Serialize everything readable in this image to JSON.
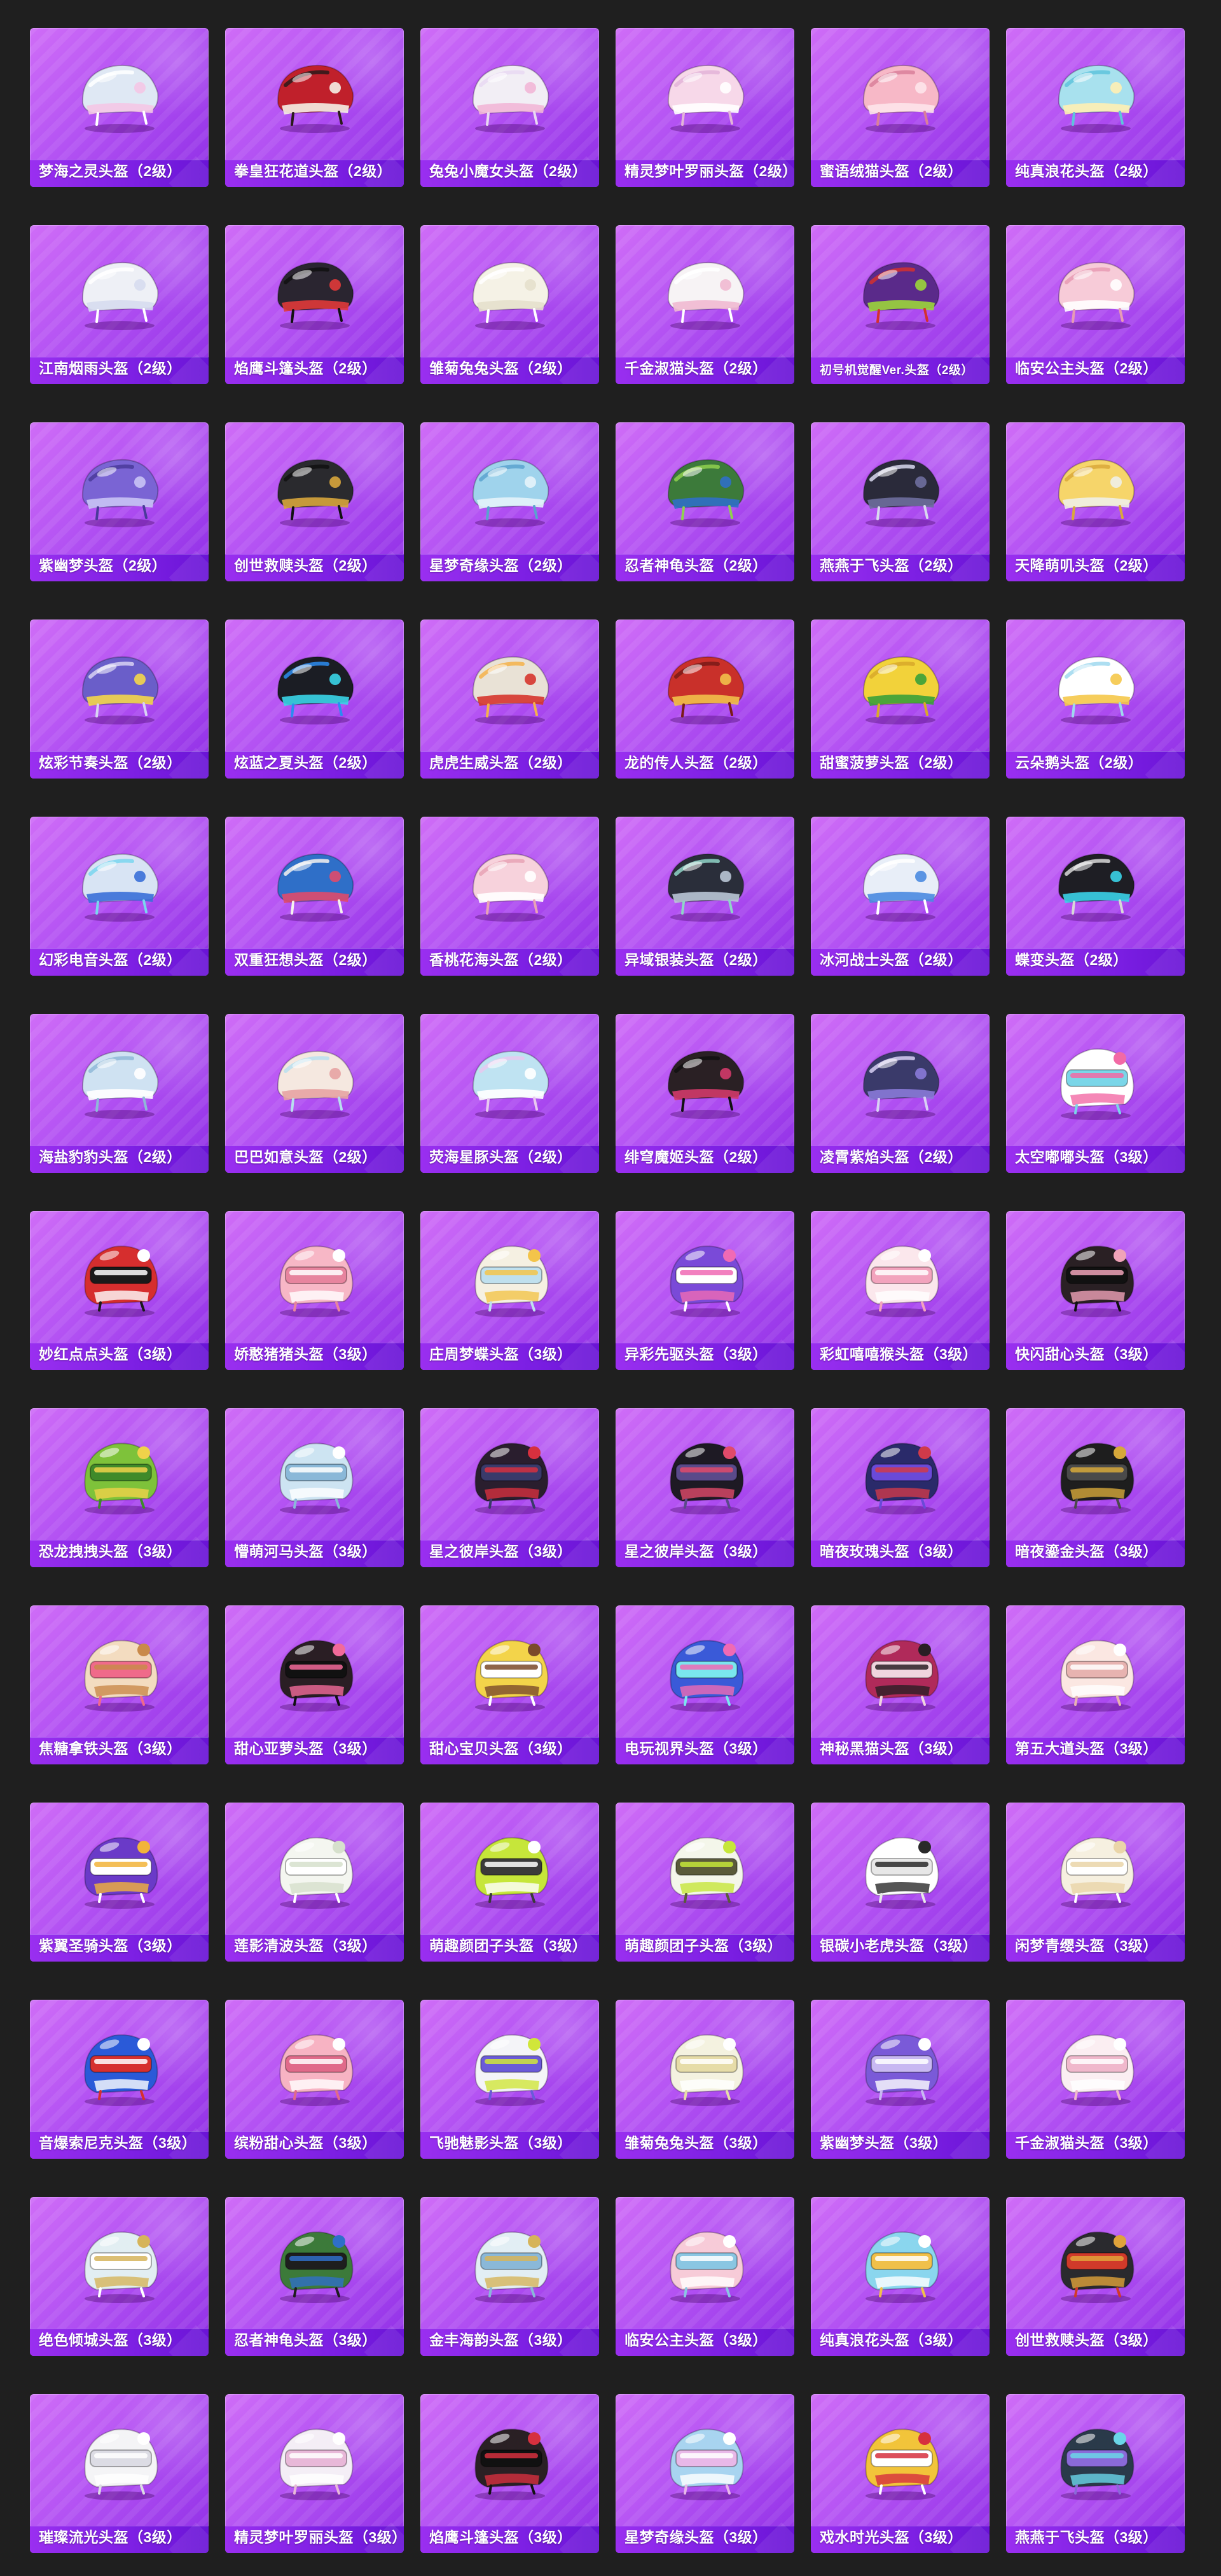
{
  "items": [
    {
      "name": "梦海之灵头盔（2级）",
      "icon": "helmet-icon",
      "colors": [
        "#dfe8f4",
        "#f4c6e6",
        "#ffffff"
      ]
    },
    {
      "name": "拳皇狂花道头盔（2级）",
      "icon": "helmet-icon",
      "colors": [
        "#c0202b",
        "#f5efe6",
        "#2a1a1a"
      ]
    },
    {
      "name": "兔兔小魔女头盔（2级）",
      "icon": "helmet-icon",
      "colors": [
        "#f2eef5",
        "#f2b6d7",
        "#e9d8f2"
      ]
    },
    {
      "name": "精灵梦叶罗丽头盔（2级）",
      "icon": "helmet-icon",
      "colors": [
        "#f7d8e9",
        "#ffffff",
        "#e3b4d8"
      ]
    },
    {
      "name": "蜜语绒猫头盔（2级）",
      "icon": "helmet-icon",
      "colors": [
        "#f7b8c7",
        "#fde4ea",
        "#d97f9a"
      ]
    },
    {
      "name": "纯真浪花头盔（2级）",
      "icon": "helmet-icon",
      "colors": [
        "#a8e1ee",
        "#fff0b3",
        "#5fc3dc"
      ]
    },
    {
      "name": "江南烟雨头盔（2级）",
      "icon": "helmet-icon",
      "colors": [
        "#eef0f6",
        "#d6dcef",
        "#ffffff"
      ]
    },
    {
      "name": "焰鹰斗篷头盔（2级）",
      "icon": "helmet-icon",
      "colors": [
        "#2a2530",
        "#e03a3a",
        "#111111"
      ]
    },
    {
      "name": "雏菊兔兔头盔（2级）",
      "icon": "helmet-icon",
      "colors": [
        "#f5f2e6",
        "#e6e0cc",
        "#ffffff"
      ]
    },
    {
      "name": "千金淑猫头盔（2级）",
      "icon": "helmet-icon",
      "colors": [
        "#f7f3f5",
        "#f0b9d1",
        "#ffffff"
      ]
    },
    {
      "name": "初号机觉醒Ver.头盔（2级）",
      "icon": "helmet-icon",
      "colors": [
        "#5a2a8a",
        "#9bd53a",
        "#d4302e"
      ]
    },
    {
      "name": "临安公主头盔（2级）",
      "icon": "helmet-icon",
      "colors": [
        "#f7cbd8",
        "#ffffff",
        "#e79bb4"
      ]
    },
    {
      "name": "紫幽梦头盔（2级）",
      "icon": "helmet-icon",
      "colors": [
        "#7a64d4",
        "#c9c3f5",
        "#4a3a9a"
      ]
    },
    {
      "name": "创世救赎头盔（2级）",
      "icon": "helmet-icon",
      "colors": [
        "#2a2a2e",
        "#d7a53c",
        "#111111"
      ]
    },
    {
      "name": "星梦奇缘头盔（2级）",
      "icon": "helmet-icon",
      "colors": [
        "#9fd3ec",
        "#e4f3fb",
        "#5aa2cf"
      ]
    },
    {
      "name": "忍者神龟头盔（2级）",
      "icon": "helmet-icon",
      "colors": [
        "#3c7a3a",
        "#2f6fc8",
        "#8fd14f"
      ]
    },
    {
      "name": "燕燕于飞头盔（2级）",
      "icon": "helmet-icon",
      "colors": [
        "#2a2a3a",
        "#6e6e9e",
        "#d8d8ee"
      ]
    },
    {
      "name": "天降萌叽头盔（2级）",
      "icon": "helmet-icon",
      "colors": [
        "#f6d56a",
        "#f0efe8",
        "#d9a83a"
      ]
    },
    {
      "name": "炫彩节奏头盔（2级）",
      "icon": "helmet-icon",
      "colors": [
        "#6a5ec9",
        "#f4d64a",
        "#d8d2f3"
      ]
    },
    {
      "name": "炫蓝之夏头盔（2级）",
      "icon": "helmet-icon",
      "colors": [
        "#1b1d24",
        "#3ad5e8",
        "#2b8cf0"
      ]
    },
    {
      "name": "虎虎生威头盔（2级）",
      "icon": "helmet-icon",
      "colors": [
        "#e9e2d6",
        "#d6362e",
        "#f4b24a"
      ]
    },
    {
      "name": "龙的传人头盔（2级）",
      "icon": "helmet-icon",
      "colors": [
        "#c9302a",
        "#f1c04a",
        "#7a1a18"
      ]
    },
    {
      "name": "甜蜜菠萝头盔（2级）",
      "icon": "helmet-icon",
      "colors": [
        "#f2d23a",
        "#3aa03a",
        "#d8a92a"
      ]
    },
    {
      "name": "云朵鹅头盔（2级）",
      "icon": "helmet-icon",
      "colors": [
        "#ffffff",
        "#f5c84a",
        "#9fd8ee"
      ]
    },
    {
      "name": "幻彩电音头盔（2级）",
      "icon": "helmet-icon",
      "colors": [
        "#d8e4f4",
        "#3a6fd8",
        "#7ad6ee"
      ]
    },
    {
      "name": "双重狂想头盔（2级）",
      "icon": "helmet-icon",
      "colors": [
        "#2f6fc8",
        "#e04a6a",
        "#f5f2ee"
      ]
    },
    {
      "name": "香桃花海头盔（2级）",
      "icon": "helmet-icon",
      "colors": [
        "#f7d2dc",
        "#ffffff",
        "#e8a3b5"
      ]
    },
    {
      "name": "异域银装头盔（2级）",
      "icon": "helmet-icon",
      "colors": [
        "#2a2e3a",
        "#b9c6d6",
        "#8fd4c8"
      ]
    },
    {
      "name": "冰河战士头盔（2级）",
      "icon": "helmet-icon",
      "colors": [
        "#e8eef8",
        "#4a8ae0",
        "#ffffff"
      ]
    },
    {
      "name": "蝶变头盔（2级）",
      "icon": "helmet-icon",
      "colors": [
        "#1e1e24",
        "#3ad1e8",
        "#d8d8d8"
      ]
    },
    {
      "name": "海盐豹豹头盔（2级）",
      "icon": "helmet-icon",
      "colors": [
        "#cfe2f2",
        "#ffffff",
        "#8fb8d8"
      ]
    },
    {
      "name": "巴巴如意头盔（2级）",
      "icon": "helmet-icon",
      "colors": [
        "#f5e8e0",
        "#e7a3a3",
        "#b8dfee"
      ]
    },
    {
      "name": "荧海星豚头盔（2级）",
      "icon": "helmet-icon",
      "colors": [
        "#bfe3f2",
        "#ffffff",
        "#e8c8f0"
      ]
    },
    {
      "name": "绯穹魔姬头盔（2级）",
      "icon": "helmet-icon",
      "colors": [
        "#2a2024",
        "#d23a6a",
        "#111111"
      ]
    },
    {
      "name": "凌霄紫焰头盔（2级）",
      "icon": "helmet-icon",
      "colors": [
        "#3a3a6a",
        "#8a7ad8",
        "#d8d0f4"
      ]
    },
    {
      "name": "太空嘟嘟头盔（3级）",
      "icon": "helmet-icon",
      "colors": [
        "#ffffff",
        "#f26aa5",
        "#7ad6e8"
      ]
    },
    {
      "name": "妙红点点头盔（3级）",
      "icon": "helmet-icon",
      "colors": [
        "#d62e2e",
        "#ffffff",
        "#1a1a1a"
      ]
    },
    {
      "name": "娇憨猪猪头盔（3级）",
      "icon": "helmet-icon",
      "colors": [
        "#f7b7c6",
        "#ffffff",
        "#e7849e"
      ]
    },
    {
      "name": "庄周梦蝶头盔（3级）",
      "icon": "helmet-icon",
      "colors": [
        "#f5f0e2",
        "#f3c44a",
        "#bfe0ee"
      ]
    },
    {
      "name": "异彩先驱头盔（3级）",
      "icon": "helmet-icon",
      "colors": [
        "#7a4ad8",
        "#f06ab4",
        "#ffffff"
      ]
    },
    {
      "name": "彩虹嘻嘻猴头盔（3级）",
      "icon": "helmet-icon",
      "colors": [
        "#fbe7ec",
        "#ffffff",
        "#f2a3bd"
      ]
    },
    {
      "name": "快闪甜心头盔（3级）",
      "icon": "helmet-icon",
      "colors": [
        "#2a2024",
        "#f0a3b8",
        "#111111"
      ]
    },
    {
      "name": "恐龙拽拽头盔（3级）",
      "icon": "helmet-icon",
      "colors": [
        "#7ec23a",
        "#f0d24a",
        "#3f8a2a"
      ]
    },
    {
      "name": "懵萌河马头盔（3级）",
      "icon": "helmet-icon",
      "colors": [
        "#cde4f2",
        "#ffffff",
        "#8ab8d8"
      ]
    },
    {
      "name": "星之彼岸头盔（3级）",
      "icon": "helmet-icon",
      "colors": [
        "#2a1e2e",
        "#d6303e",
        "#3a3a6a"
      ]
    },
    {
      "name": "星之彼岸头盔（3级）",
      "icon": "helmet-icon",
      "colors": [
        "#1e1a24",
        "#e04a6a",
        "#5a4a8a"
      ]
    },
    {
      "name": "暗夜玫瑰头盔（3级）",
      "icon": "helmet-icon",
      "colors": [
        "#2a2a6a",
        "#d03a4a",
        "#6a4ad8"
      ]
    },
    {
      "name": "暗夜鎏金头盔（3级）",
      "icon": "helmet-icon",
      "colors": [
        "#1e1e1e",
        "#d6a83a",
        "#4a4a4a"
      ]
    },
    {
      "name": "焦糖拿铁头盔（3级）",
      "icon": "helmet-icon",
      "colors": [
        "#f3dcc0",
        "#c98a4a",
        "#f06a8a"
      ]
    },
    {
      "name": "甜心亚萝头盔（3级）",
      "icon": "helmet-icon",
      "colors": [
        "#2a1e24",
        "#f26a9a",
        "#111111"
      ]
    },
    {
      "name": "甜心宝贝头盔（3级）",
      "icon": "helmet-icon",
      "colors": [
        "#f3d44a",
        "#7a4a2a",
        "#ffffff"
      ]
    },
    {
      "name": "电玩视界头盔（3级）",
      "icon": "helmet-icon",
      "colors": [
        "#3a5ad8",
        "#f06ab4",
        "#7ae6ee"
      ]
    },
    {
      "name": "神秘黑猫头盔（3级）",
      "icon": "helmet-icon",
      "colors": [
        "#b02a5a",
        "#2a1e24",
        "#f0d4de"
      ]
    },
    {
      "name": "第五大道头盔（3级）",
      "icon": "helmet-icon",
      "colors": [
        "#fbe7e2",
        "#ffffff",
        "#e7b3b0"
      ]
    },
    {
      "name": "紫翼圣骑头盔（3级）",
      "icon": "helmet-icon",
      "colors": [
        "#6a3ac8",
        "#f2b43a",
        "#ffffff"
      ]
    },
    {
      "name": "莲影清波头盔（3级）",
      "icon": "helmet-icon",
      "colors": [
        "#f4f6f0",
        "#d6e0cc",
        "#ffffff"
      ]
    },
    {
      "name": "萌趣颜团子头盔（3级）",
      "icon": "helmet-icon",
      "colors": [
        "#c6e63a",
        "#ffffff",
        "#3a3a3a"
      ]
    },
    {
      "name": "萌趣颜团子头盔（3级）",
      "icon": "helmet-icon",
      "colors": [
        "#f4f6ea",
        "#c6e63a",
        "#5a5a3a"
      ]
    },
    {
      "name": "银碳小老虎头盔（3级）",
      "icon": "helmet-icon",
      "colors": [
        "#ffffff",
        "#2a2a2a",
        "#e7e7e7"
      ]
    },
    {
      "name": "闲梦青缨头盔（3级）",
      "icon": "helmet-icon",
      "colors": [
        "#f6f0e0",
        "#ead5a8",
        "#ffffff"
      ]
    },
    {
      "name": "音爆索尼克头盔（3级）",
      "icon": "helmet-icon",
      "colors": [
        "#2a5ad8",
        "#ffffff",
        "#d6302e"
      ]
    },
    {
      "name": "缤粉甜心头盔（3级）",
      "icon": "helmet-icon",
      "colors": [
        "#f7b3c3",
        "#ffffff",
        "#e06a8a"
      ]
    },
    {
      "name": "飞驰魅影头盔（3级）",
      "icon": "helmet-icon",
      "colors": [
        "#f4f4f8",
        "#d0e63a",
        "#6a5ad8"
      ]
    },
    {
      "name": "雏菊兔兔头盔（3级）",
      "icon": "helmet-icon",
      "colors": [
        "#f4f2e0",
        "#ffffff",
        "#e6dca8"
      ]
    },
    {
      "name": "紫幽梦头盔（3级）",
      "icon": "helmet-icon",
      "colors": [
        "#7a5ad8",
        "#ffffff",
        "#c8b8f2"
      ]
    },
    {
      "name": "千金淑猫头盔（3级）",
      "icon": "helmet-icon",
      "colors": [
        "#fbeef2",
        "#ffffff",
        "#f0b8cc"
      ]
    },
    {
      "name": "绝色倾城头盔（3级）",
      "icon": "helmet-icon",
      "colors": [
        "#e2eef2",
        "#d6b45a",
        "#ffffff"
      ]
    },
    {
      "name": "忍者神龟头盔（3级）",
      "icon": "helmet-icon",
      "colors": [
        "#3c7a3a",
        "#2f6fc8",
        "#1e1e1e"
      ]
    },
    {
      "name": "金丰海韵头盔（3级）",
      "icon": "helmet-icon",
      "colors": [
        "#e2eef4",
        "#d6b45a",
        "#8ab8d8"
      ]
    },
    {
      "name": "临安公主头盔（3级）",
      "icon": "helmet-icon",
      "colors": [
        "#f7cbd8",
        "#ffffff",
        "#8ac6e2"
      ]
    },
    {
      "name": "纯真浪花头盔（3级）",
      "icon": "helmet-icon",
      "colors": [
        "#8ad6ee",
        "#ffffff",
        "#f0c04a"
      ]
    },
    {
      "name": "创世救赎头盔（3级）",
      "icon": "helmet-icon",
      "colors": [
        "#2a2a2e",
        "#e0a33a",
        "#d03a2a"
      ]
    },
    {
      "name": "璀璨流光头盔（3级）",
      "icon": "helmet-icon",
      "colors": [
        "#f4f4f6",
        "#ffffff",
        "#dcdce4"
      ]
    },
    {
      "name": "精灵梦叶罗丽头盔（3级）",
      "icon": "helmet-icon",
      "colors": [
        "#f4eef6",
        "#ffffff",
        "#e8b8d8"
      ]
    },
    {
      "name": "焰鹰斗篷头盔（3级）",
      "icon": "helmet-icon",
      "colors": [
        "#2a2024",
        "#d6303e",
        "#111111"
      ]
    },
    {
      "name": "星梦奇缘头盔（3级）",
      "icon": "helmet-icon",
      "colors": [
        "#a8d4f0",
        "#ffffff",
        "#e8b8e8"
      ]
    },
    {
      "name": "戏水时光头盔（3级）",
      "icon": "helmet-icon",
      "colors": [
        "#f2c43a",
        "#d6303e",
        "#ffffff"
      ]
    },
    {
      "name": "燕燕于飞头盔（3级）",
      "icon": "helmet-icon",
      "colors": [
        "#2a3a4a",
        "#6ad6e8",
        "#8a6ad8"
      ]
    }
  ]
}
